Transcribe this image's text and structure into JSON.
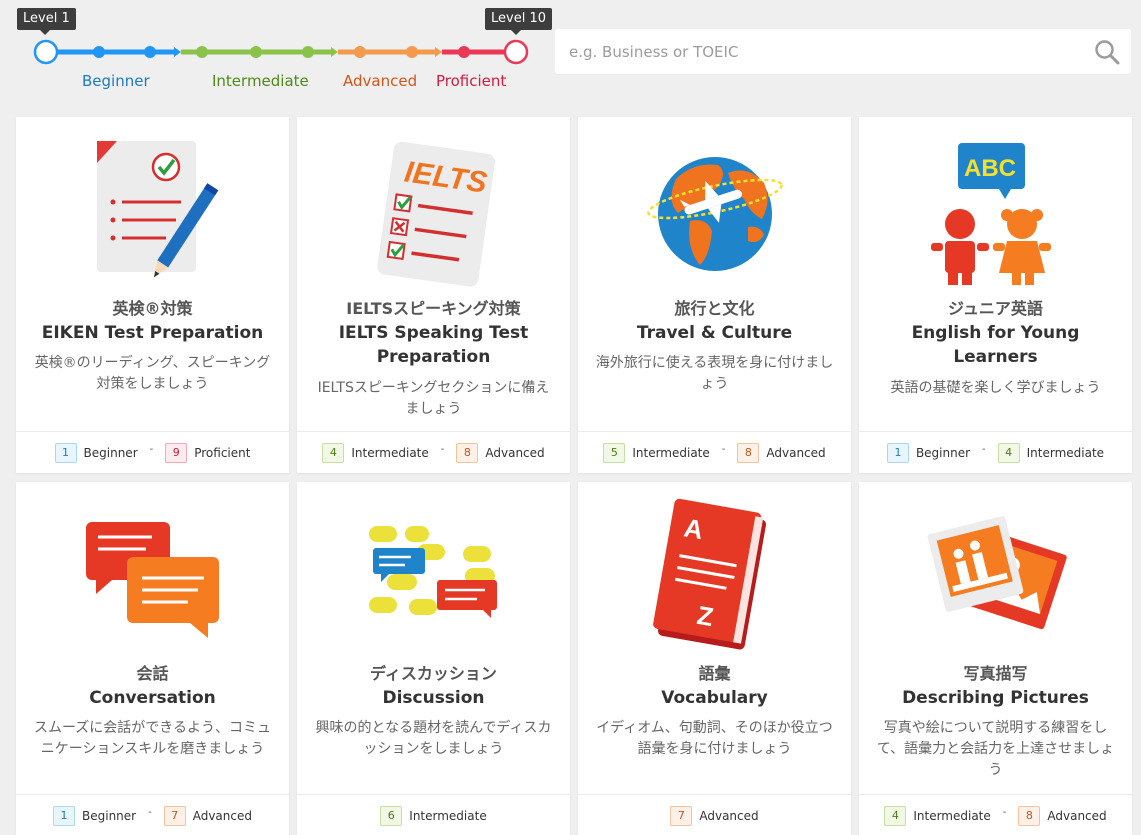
{
  "level_bar": {
    "min_label": "Level 1",
    "max_label": "Level 10",
    "bands": [
      {
        "label": "Beginner",
        "color": "#1e7ac0",
        "line": "#2196f3"
      },
      {
        "label": "Intermediate",
        "color": "#4f8a17",
        "line": "#8bc34a"
      },
      {
        "label": "Advanced",
        "color": "#d2561b",
        "line": "#f39a4c"
      },
      {
        "label": "Proficient",
        "color": "#d11b3f",
        "line": "#ea3957"
      }
    ],
    "selected_min": 1,
    "selected_max": 10
  },
  "search": {
    "placeholder": "e.g. Business or TOEIC",
    "value": ""
  },
  "courses": [
    {
      "title_ja": "英検®対策",
      "title_en": "EIKEN Test Preparation",
      "desc": "英検®のリーディング、スピーキング対策をしましょう",
      "icon": "eiken-document-icon",
      "from": {
        "n": "1",
        "label": "Beginner",
        "tier": "beg"
      },
      "to": {
        "n": "9",
        "label": "Proficient",
        "tier": "pro"
      }
    },
    {
      "title_ja": "IELTSスピーキング対策",
      "title_en": "IELTS Speaking Test Preparation",
      "desc": "IELTSスピーキングセクションに備えましょう",
      "icon": "ielts-checklist-icon",
      "illus_text": "IELTS",
      "from": {
        "n": "4",
        "label": "Intermediate",
        "tier": "int"
      },
      "to": {
        "n": "8",
        "label": "Advanced",
        "tier": "adv"
      }
    },
    {
      "title_ja": "旅行と文化",
      "title_en": "Travel & Culture",
      "desc": "海外旅行に使える表現を身に付けましょう",
      "icon": "globe-airplane-icon",
      "from": {
        "n": "5",
        "label": "Intermediate",
        "tier": "int"
      },
      "to": {
        "n": "8",
        "label": "Advanced",
        "tier": "adv"
      }
    },
    {
      "title_ja": "ジュニア英語",
      "title_en": "English for Young Learners",
      "desc": "英語の基礎を楽しく学びましょう",
      "icon": "children-abc-icon",
      "illus_text": "ABC",
      "from": {
        "n": "1",
        "label": "Beginner",
        "tier": "beg"
      },
      "to": {
        "n": "4",
        "label": "Intermediate",
        "tier": "int"
      }
    },
    {
      "title_ja": "会話",
      "title_en": "Conversation",
      "desc": "スムーズに会話ができるよう、コミュニケーションスキルを磨きましょう",
      "icon": "speech-bubbles-icon",
      "from": {
        "n": "1",
        "label": "Beginner",
        "tier": "beg"
      },
      "to": {
        "n": "7",
        "label": "Advanced",
        "tier": "adv"
      }
    },
    {
      "title_ja": "ディスカッション",
      "title_en": "Discussion",
      "desc": "興味の的となる題材を読んでディスカッションをしましょう",
      "icon": "discussion-bubbles-icon",
      "from": {
        "n": "6",
        "label": "Intermediate",
        "tier": "int"
      },
      "to": null
    },
    {
      "title_ja": "語彙",
      "title_en": "Vocabulary",
      "desc": "イディオム、句動詞、そのほか役立つ語彙を身に付けましょう",
      "icon": "dictionary-book-icon",
      "illus_text_a": "A",
      "illus_text_z": "Z",
      "from": {
        "n": "7",
        "label": "Advanced",
        "tier": "adv"
      },
      "to": null
    },
    {
      "title_ja": "写真描写",
      "title_en": "Describing Pictures",
      "desc": "写真や絵について説明する練習をして、語彙力と会話力を上達させましょう",
      "icon": "photos-icon",
      "from": {
        "n": "4",
        "label": "Intermediate",
        "tier": "int"
      },
      "to": {
        "n": "8",
        "label": "Advanced",
        "tier": "adv"
      }
    }
  ]
}
